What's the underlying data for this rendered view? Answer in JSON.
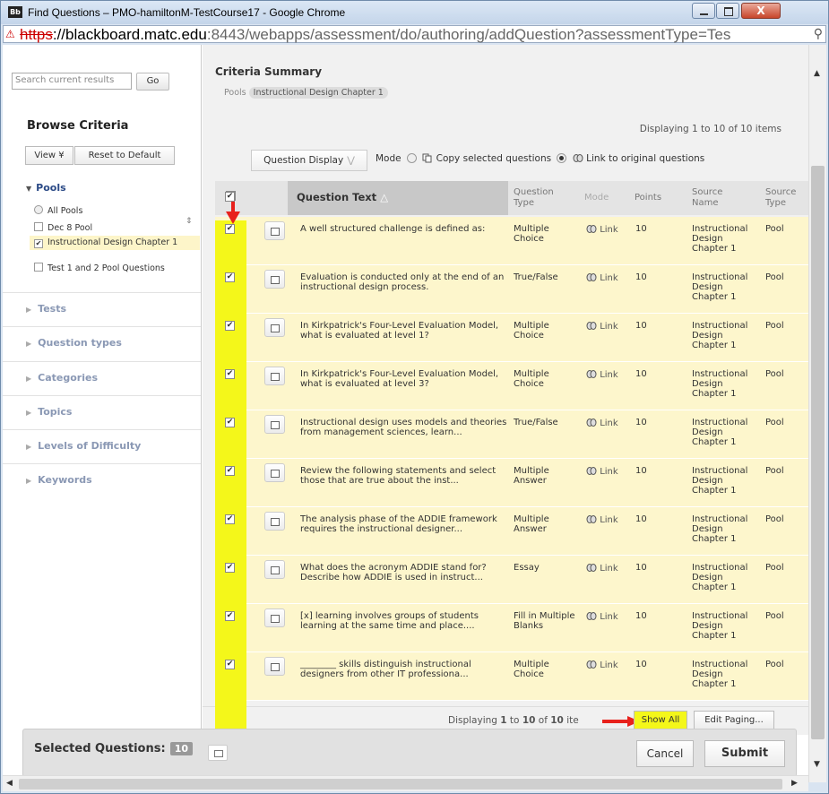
{
  "window": {
    "title": "Find Questions – PMO-hamiltonM-TestCourse17 - Google Chrome",
    "logo": "Bb",
    "close": "X"
  },
  "address": {
    "scheme": "https",
    "host": "://blackboard.matc.edu",
    "path": ":8443/webapps/assessment/do/authoring/addQuestion?assessmentType=Tes"
  },
  "left": {
    "search_placeholder": "Search current results",
    "go": "Go",
    "browse_title": "Browse Criteria",
    "view": "View ¥",
    "reset": "Reset to Default",
    "pools_heading": "Pools",
    "pools": [
      {
        "label": "All Pools",
        "type": "radio",
        "checked": false
      },
      {
        "label": "Dec 8 Pool",
        "type": "checkbox",
        "checked": false
      },
      {
        "label": "Instructional Design Chapter 1",
        "type": "checkbox",
        "checked": true
      },
      {
        "label": "Test 1 and 2 Pool Questions",
        "type": "checkbox",
        "checked": false
      }
    ],
    "categories": [
      "Tests",
      "Question types",
      "Categories",
      "Topics",
      "Levels of Difficulty",
      "Keywords"
    ]
  },
  "right": {
    "criteria_title": "Criteria Summary",
    "pools_label": "Pools",
    "pools_tag": "Instructional Design Chapter 1",
    "displaying_top": "Displaying 1 to 10 of 10 items",
    "question_display": "Question Display",
    "mode_label": "Mode",
    "copy_label": "Copy selected questions",
    "link_label": "Link to original questions",
    "columns": {
      "text": "Question Text",
      "type": "Question Type",
      "mode": "Mode",
      "points": "Points",
      "source_name": "Source Name",
      "source_type": "Source Type"
    },
    "rows": [
      {
        "text": "A well structured challenge is defined as:",
        "type": "Multiple Choice",
        "mode": "Link",
        "points": "10",
        "source": "Instructional Design Chapter 1",
        "stype": "Pool"
      },
      {
        "text": "Evaluation is conducted only at the end of an instructional design process.",
        "type": "True/False",
        "mode": "Link",
        "points": "10",
        "source": "Instructional Design Chapter 1",
        "stype": "Pool"
      },
      {
        "text": "In Kirkpatrick's Four-Level Evaluation Model, what is evaluated at level 1?",
        "type": "Multiple Choice",
        "mode": "Link",
        "points": "10",
        "source": "Instructional Design Chapter 1",
        "stype": "Pool"
      },
      {
        "text": "In Kirkpatrick's Four-Level Evaluation Model, what is evaluated at level 3?",
        "type": "Multiple Choice",
        "mode": "Link",
        "points": "10",
        "source": "Instructional Design Chapter 1",
        "stype": "Pool"
      },
      {
        "text": "Instructional design uses models and theories from management sciences, learn...",
        "type": "True/False",
        "mode": "Link",
        "points": "10",
        "source": "Instructional Design Chapter 1",
        "stype": "Pool"
      },
      {
        "text": "Review the following statements and select those that are true about the inst...",
        "type": "Multiple Answer",
        "mode": "Link",
        "points": "10",
        "source": "Instructional Design Chapter 1",
        "stype": "Pool"
      },
      {
        "text": "The analysis phase of the ADDIE framework requires the instructional designer...",
        "type": "Multiple Answer",
        "mode": "Link",
        "points": "10",
        "source": "Instructional Design Chapter 1",
        "stype": "Pool"
      },
      {
        "text": "What does the acronym ADDIE stand for? Describe how ADDIE is used in instruct...",
        "type": "Essay",
        "mode": "Link",
        "points": "10",
        "source": "Instructional Design Chapter 1",
        "stype": "Pool"
      },
      {
        "text": "[x] learning involves groups of students learning at the same time and place....",
        "type": "Fill in Multiple Blanks",
        "mode": "Link",
        "points": "10",
        "source": "Instructional Design Chapter 1",
        "stype": "Pool"
      },
      {
        "text": "________ skills distinguish instructional designers from other IT professiona...",
        "type": "Multiple Choice",
        "mode": "Link",
        "points": "10",
        "source": "Instructional Design Chapter 1",
        "stype": "Pool"
      }
    ],
    "displaying_bottom_pre": "Displaying ",
    "displaying_bottom_from": "1",
    "displaying_bottom_mid1": " to ",
    "displaying_bottom_to": "10",
    "displaying_bottom_mid2": " of ",
    "displaying_bottom_total": "10",
    "displaying_bottom_post": " ite",
    "show_all": "Show All",
    "edit_paging": "Edit Paging..."
  },
  "footer": {
    "selected_label": "Selected Questions:",
    "selected_count": "10",
    "cancel": "Cancel",
    "submit": "Submit"
  },
  "colors": {
    "highlight": "#f4f71a",
    "row_bg": "#fdf6cc",
    "arrow": "#e8211c"
  }
}
